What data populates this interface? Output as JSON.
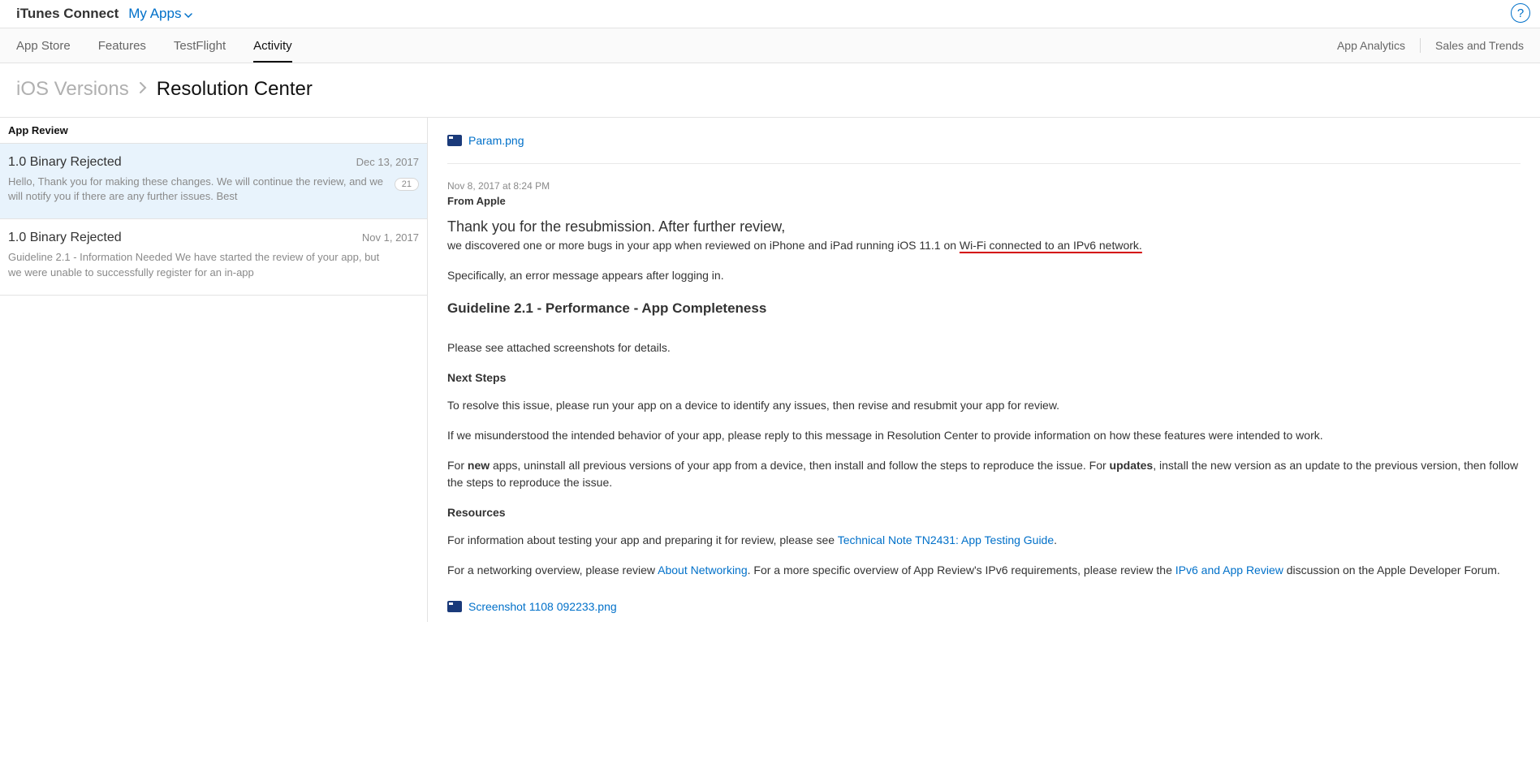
{
  "header": {
    "brand": "iTunes Connect",
    "myApps": "My Apps",
    "help": "?"
  },
  "tabs": {
    "left": [
      "App Store",
      "Features",
      "TestFlight",
      "Activity"
    ],
    "activeIndex": 3,
    "right": [
      "App Analytics",
      "Sales and Trends"
    ]
  },
  "breadcrumb": {
    "parent": "iOS Versions",
    "current": "Resolution Center"
  },
  "sidebar": {
    "sectionTitle": "App Review",
    "items": [
      {
        "title": "1.0 Binary Rejected",
        "date": "Dec 13, 2017",
        "preview": "Hello, Thank you for making these changes. We will continue the review, and we will notify you if there are any further issues. Best",
        "badge": "21",
        "selected": true
      },
      {
        "title": "1.0 Binary Rejected",
        "date": "Nov 1, 2017",
        "preview": "Guideline 2.1 - Information Needed We have started the review of your app, but we were unable to successfully register for an in-app",
        "badge": "",
        "selected": false
      }
    ]
  },
  "message": {
    "topAttachment": "Param.png",
    "timestamp": "Nov 8, 2017 at 8:24 PM",
    "from": "From Apple",
    "headline": "Thank you for the resubmission. After further review,",
    "line1_pre": "we discovered one or more bugs in your app when reviewed on iPhone and iPad running iOS 11.1 on ",
    "line1_underlined": "Wi-Fi connected to an IPv6 network.",
    "line2": "Specifically, an error message appears after logging in.",
    "guidelineTitle": "Guideline 2.1 - Performance - App Completeness",
    "attachNote": "Please see attached screenshots for details.",
    "nextStepsLabel": "Next Steps",
    "step1": "To resolve this issue, please run your app on a device to identify any issues, then revise and resubmit your app for review.",
    "step2": "If we misunderstood the intended behavior of your app, please reply to this message in Resolution Center to provide information on how these features were intended to work.",
    "step3_pre": "For ",
    "step3_bold1": "new",
    "step3_mid": " apps, uninstall all previous versions of your app from a device, then install and follow the steps to reproduce the issue. For ",
    "step3_bold2": "updates",
    "step3_post": ", install the new version as an update to the previous version, then follow the steps to reproduce the issue.",
    "resourcesLabel": "Resources",
    "res1_pre": "For information about testing your app and preparing it for review, please see ",
    "res1_link": "Technical Note TN2431: App Testing Guide",
    "res1_post": ".",
    "res2_pre": "For a networking overview, please review ",
    "res2_link1": "About Networking",
    "res2_mid": ". For a more specific overview of App Review's IPv6 requirements, please review the ",
    "res2_link2": "IPv6 and App Review",
    "res2_post": " discussion on the Apple Developer Forum.",
    "bottomAttachment": "Screenshot 1108 092233.png"
  }
}
